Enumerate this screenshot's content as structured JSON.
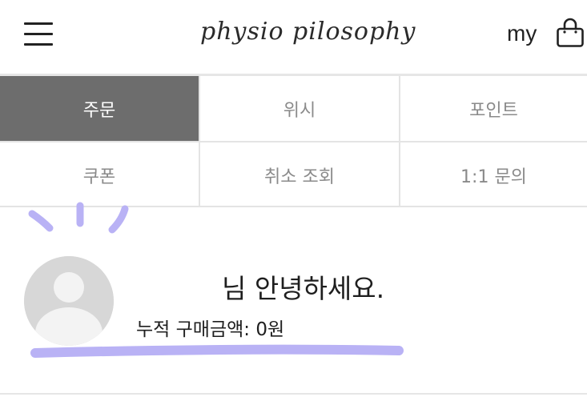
{
  "header": {
    "logo_text": "physio pilosophy",
    "my_label": "my",
    "menu_icon": "hamburger-menu-icon",
    "bag_icon": "shopping-bag-icon"
  },
  "tabs": [
    {
      "label": "주문",
      "active": true
    },
    {
      "label": "위시",
      "active": false
    },
    {
      "label": "포인트",
      "active": false
    },
    {
      "label": "쿠폰",
      "active": false
    },
    {
      "label": "취소 조회",
      "active": false
    },
    {
      "label": "1:1 문의",
      "active": false
    }
  ],
  "profile": {
    "greeting": "님 안녕하세요.",
    "total_purchase": "누적 구매금액: 0원",
    "avatar_icon": "user-avatar-icon"
  },
  "colors": {
    "active_tab_bg": "#6d6d6d",
    "accent_stroke": "#b9b2f5"
  }
}
